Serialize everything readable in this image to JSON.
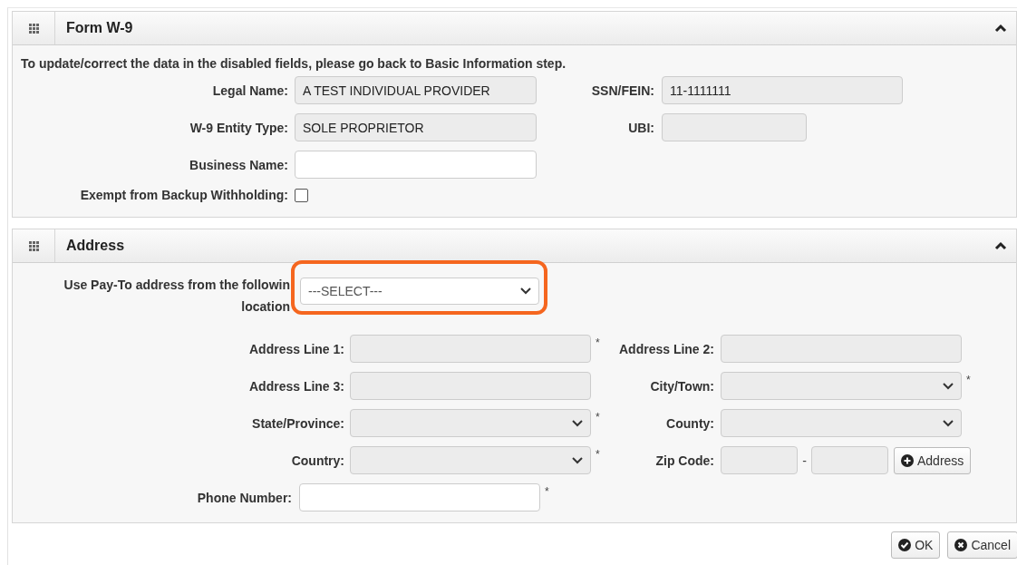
{
  "form_w9": {
    "title": "Form W-9",
    "expanded": true,
    "notice": "To update/correct the data in the disabled fields, please go back to Basic Information step.",
    "rows": [
      {
        "kind": "pair",
        "fields": [
          {
            "kind": "text",
            "label": "Legal Name:",
            "value": "A TEST INDIVIDUAL PROVIDER",
            "disabled": true
          },
          {
            "kind": "text",
            "label": "SSN/FEIN:",
            "value": "11-1111111",
            "disabled": true
          }
        ]
      },
      {
        "kind": "pair",
        "fields": [
          {
            "kind": "text",
            "label": "W-9 Entity Type:",
            "value": "SOLE PROPRIETOR",
            "disabled": true
          },
          {
            "kind": "short",
            "label": "UBI:",
            "disabled": true
          }
        ]
      },
      {
        "kind": "pair",
        "fields": [
          {
            "kind": "text",
            "label": "Business Name:",
            "disabled": false
          }
        ]
      },
      {
        "kind": "pair",
        "fields": [
          {
            "kind": "checkbox",
            "label": "Exempt from Backup Withholding:",
            "checked": false
          }
        ]
      }
    ]
  },
  "address": {
    "title": "Address",
    "expanded": true,
    "location_select": {
      "label": "Use Pay-To address from the followin location",
      "value": "---SELECT---",
      "highlighted": true
    },
    "rows": [
      {
        "kind": "pair",
        "fields": [
          {
            "kind": "text",
            "label": "Address Line 1:",
            "disabled": true,
            "required_mark": "*"
          },
          {
            "kind": "text",
            "label": "Address Line 2:",
            "disabled": true
          }
        ]
      },
      {
        "kind": "pair",
        "fields": [
          {
            "kind": "text",
            "label": "Address Line 3:",
            "disabled": true
          },
          {
            "kind": "select",
            "label": "City/Town:",
            "disabled": true,
            "required_mark": "*"
          }
        ]
      },
      {
        "kind": "pair",
        "fields": [
          {
            "kind": "select",
            "label": "State/Province:",
            "disabled": true,
            "required_mark": "*"
          },
          {
            "kind": "select",
            "label": "County:",
            "disabled": true
          }
        ]
      },
      {
        "kind": "pair",
        "fields": [
          {
            "kind": "select",
            "label": "Country:",
            "disabled": true,
            "required_mark": "*"
          },
          {
            "kind": "zip",
            "label": "Zip Code:",
            "disabled": true,
            "separator": "-",
            "button": "Address"
          }
        ]
      },
      {
        "kind": "single",
        "fields": [
          {
            "kind": "text",
            "label": "Phone Number:",
            "disabled": false,
            "required_mark": "*"
          }
        ]
      }
    ]
  },
  "buttons": [
    {
      "kind": "ok",
      "label": "OK"
    },
    {
      "kind": "cancel",
      "label": "Cancel"
    }
  ]
}
